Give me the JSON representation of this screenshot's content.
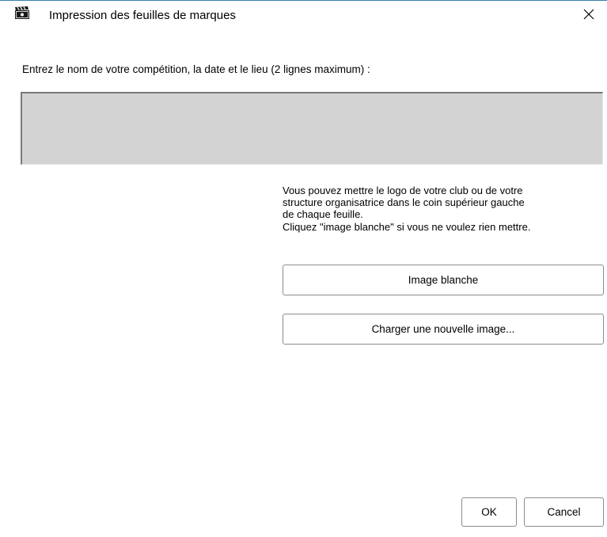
{
  "window": {
    "title": "Impression des feuilles de marques",
    "app_icon": "clapperboard-icon",
    "close_icon": "close-icon"
  },
  "form": {
    "prompt_label": "Entrez le nom de votre compétition, la date et le lieu (2 lignes maximum) :",
    "competition_value": ""
  },
  "logo": {
    "info_lines": [
      "Vous pouvez mettre le logo de votre club ou de votre",
      "structure organisatrice dans le coin supérieur gauche",
      "de chaque feuille.",
      "Cliquez \"image blanche\" si vous ne voulez rien mettre."
    ],
    "blank_image_label": "Image blanche",
    "load_image_label": "Charger une nouvelle image..."
  },
  "footer": {
    "ok_label": "OK",
    "cancel_label": "Cancel"
  },
  "colors": {
    "field_background": "#d3d3d3",
    "window_border": "#3c7fb1"
  }
}
